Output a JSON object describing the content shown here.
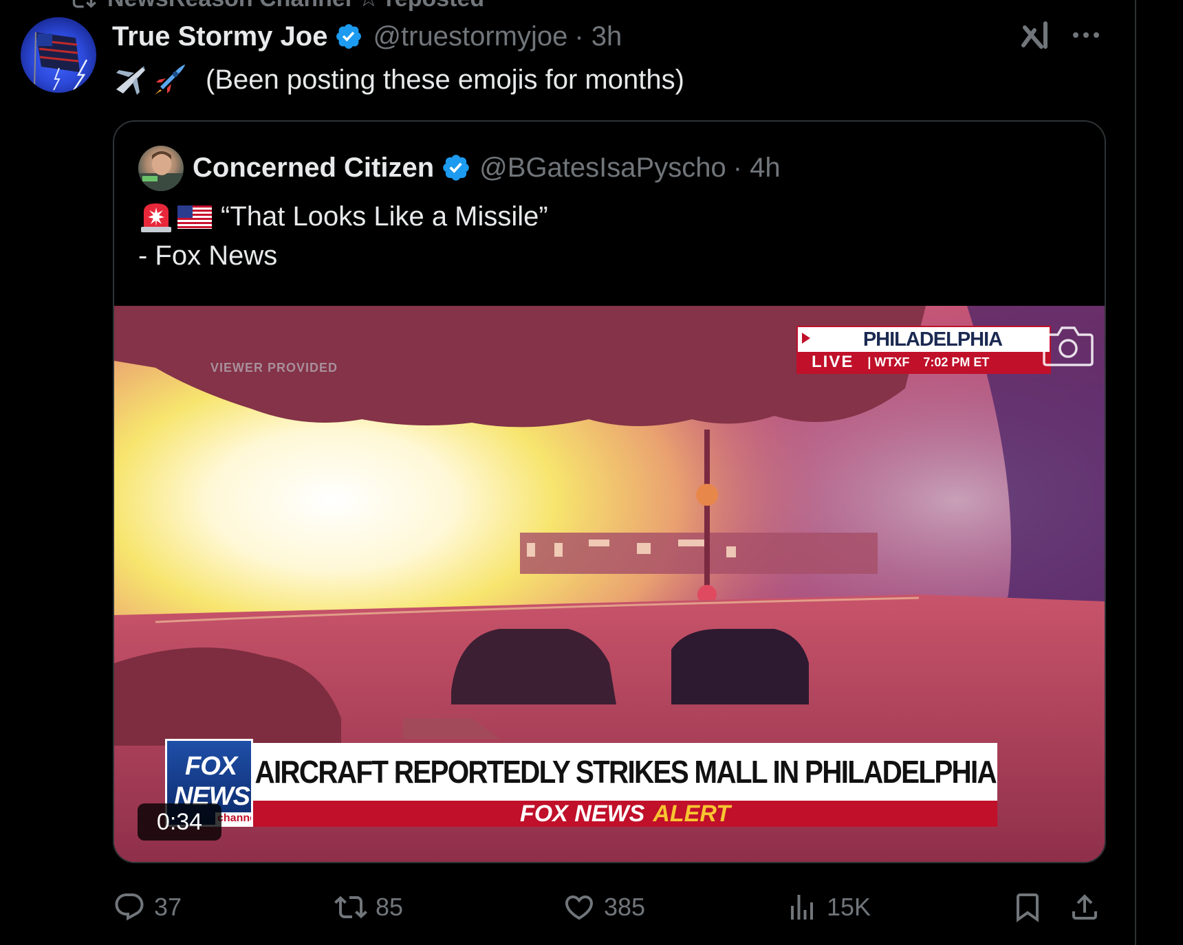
{
  "colors": {
    "background": "#000000",
    "text_primary": "#e7e9ea",
    "text_secondary": "#71767b",
    "verified_blue": "#1d9bf0",
    "border": "#2f3336"
  },
  "repost_context": {
    "icon": "repost-icon",
    "text": "NewsReason Channel ☆ reposted"
  },
  "tweet": {
    "display_name": "True Stormy Joe",
    "handle": "@truestormyjoe",
    "time": "· 3h",
    "emojis": [
      "airplane-emoji",
      "rocket-emoji"
    ],
    "text": "(Been posting these emojis for months)",
    "header_icons": [
      "grok-icon",
      "more-icon"
    ]
  },
  "quote": {
    "display_name": "Concerned Citizen",
    "handle": "@BGatesIsaPyscho",
    "time": "· 4h",
    "emojis": [
      "rotating-light-emoji",
      "us-flag-emoji"
    ],
    "line1": "“That Looks Like a Missile”",
    "line2": "- Fox News",
    "video": {
      "watermark": "VIEWER PROVIDED",
      "live_city": "PHILADELPHIA",
      "live_label": "LIVE",
      "live_station": "| WTXF",
      "live_time": "7:02 PM ET",
      "fox_logo_line1": "FOX",
      "fox_logo_line2": "NEWS",
      "fox_logo_channel": "channel",
      "chyron": "AIRCRAFT REPORTEDLY STRIKES MALL IN PHILADELPHIA",
      "alert_brand": "FOX NEWS",
      "alert_word": "ALERT",
      "duration": "0:34"
    }
  },
  "actions": {
    "replies": "37",
    "reposts": "85",
    "likes": "385",
    "views": "15K"
  }
}
